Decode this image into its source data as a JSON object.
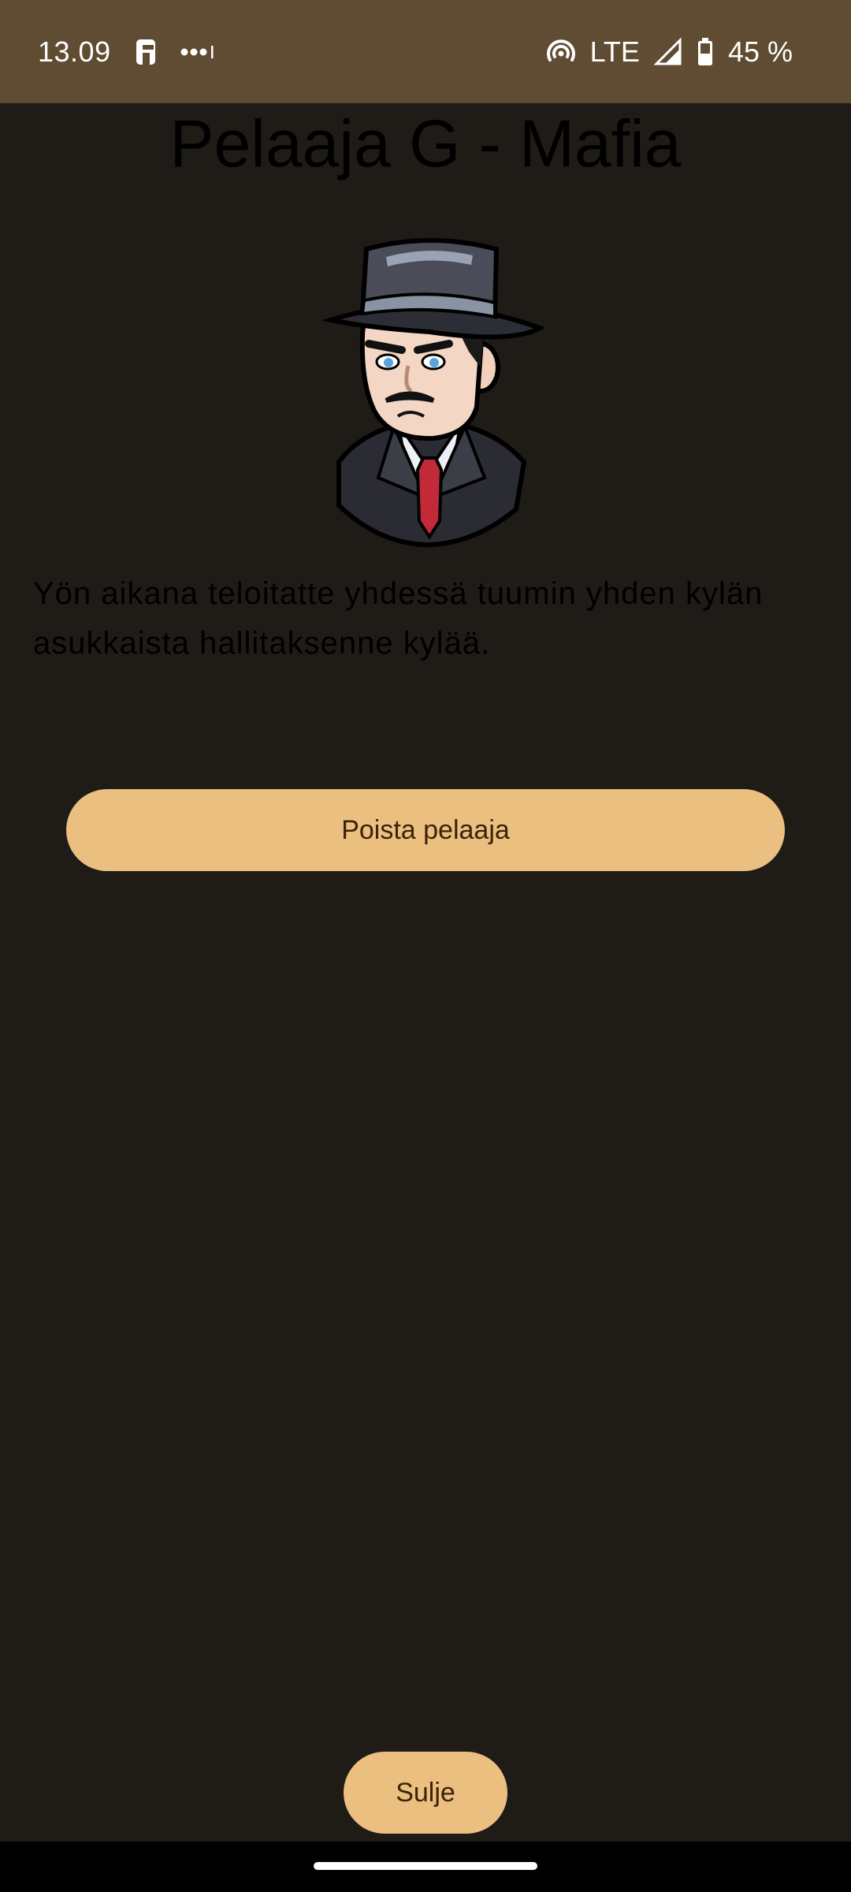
{
  "status_bar": {
    "time": "13.09",
    "network": "LTE",
    "battery": "45 %",
    "icons": [
      "app-notification-icon",
      "more-notifications-icon",
      "hotspot-icon",
      "signal-icon",
      "battery-icon"
    ]
  },
  "page": {
    "title": "Pelaaja G - Mafia",
    "image_name": "mafia-character-icon",
    "description": "Yön aikana teloitatte yhdessä tuumin yhden kylän asukkaista hallitaksenne kylää."
  },
  "actions": {
    "remove_label": "Poista pelaaja",
    "close_label": "Sulje"
  },
  "colors": {
    "status_bar": "#5f4c33",
    "background": "#1f1b17",
    "button": "#ebbf80",
    "button_text": "#3a2308"
  }
}
